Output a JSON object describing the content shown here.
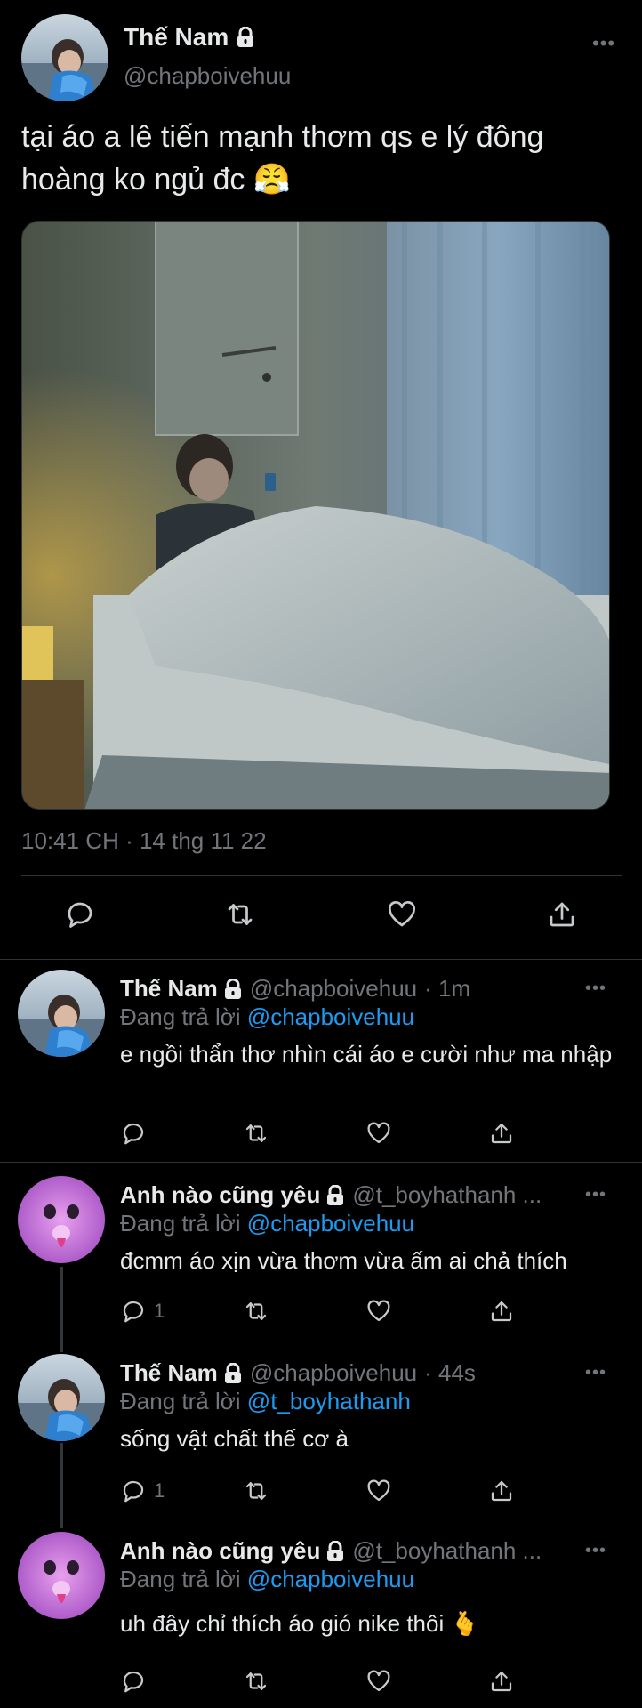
{
  "main_tweet": {
    "name": "Thế Nam",
    "handle": "@chapboivehuu",
    "text": "tại áo a lê tiến mạnh thơm qs e lý đông hoàng ko ngủ đc 😤",
    "timestamp": "10:41 CH · 14 thg 11 22",
    "actions": [
      "reply-icon",
      "retweet-icon",
      "like-icon",
      "share-icon"
    ]
  },
  "replies": [
    {
      "name": "Thế Nam",
      "handle": "@chapboivehuu",
      "time": "· 1m",
      "replying_prefix": "Đang trả lời",
      "replying_to": "@chapboivehuu",
      "text": "e ngồi thẩn thơ nhìn cái áo e cười như ma nhập",
      "reply_count": ""
    },
    {
      "name": "Anh nào cũng yêu",
      "handle": "@t_boyhathanh ...",
      "time": "",
      "replying_prefix": "Đang trả lời",
      "replying_to": "@chapboivehuu",
      "text": "đcmm áo xịn vừa thơm vừa ấm ai chả thích",
      "reply_count": "1"
    },
    {
      "name": "Thế Nam",
      "handle": "@chapboivehuu",
      "time": "· 44s",
      "replying_prefix": "Đang trả lời",
      "replying_to": "@t_boyhathanh",
      "text": "sống vật chất thế cơ à",
      "reply_count": "1"
    },
    {
      "name": "Anh nào cũng yêu",
      "handle": "@t_boyhathanh ...",
      "time": "",
      "replying_prefix": "Đang trả lời",
      "replying_to": "@chapboivehuu",
      "text": "uh đây chỉ thích áo gió nike thôi 🫰",
      "reply_count": ""
    }
  ],
  "colors": {
    "background": "#000000",
    "text": "#e7e9ea",
    "muted": "#71767b",
    "link": "#1d9bf0",
    "divider": "#2f3336"
  }
}
